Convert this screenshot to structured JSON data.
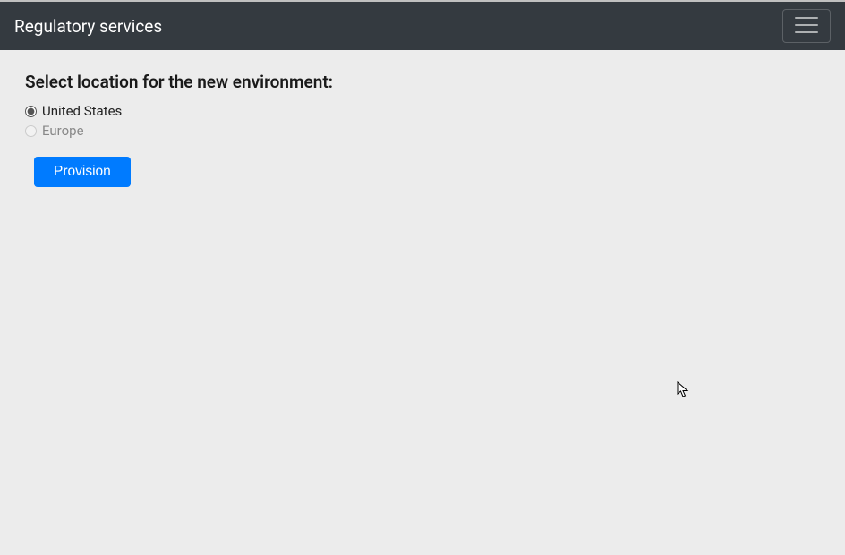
{
  "navbar": {
    "brand": "Regulatory services"
  },
  "form": {
    "heading": "Select location for the new environment:",
    "options": [
      {
        "label": "United States"
      },
      {
        "label": "Europe"
      }
    ],
    "button_label": "Provision"
  }
}
